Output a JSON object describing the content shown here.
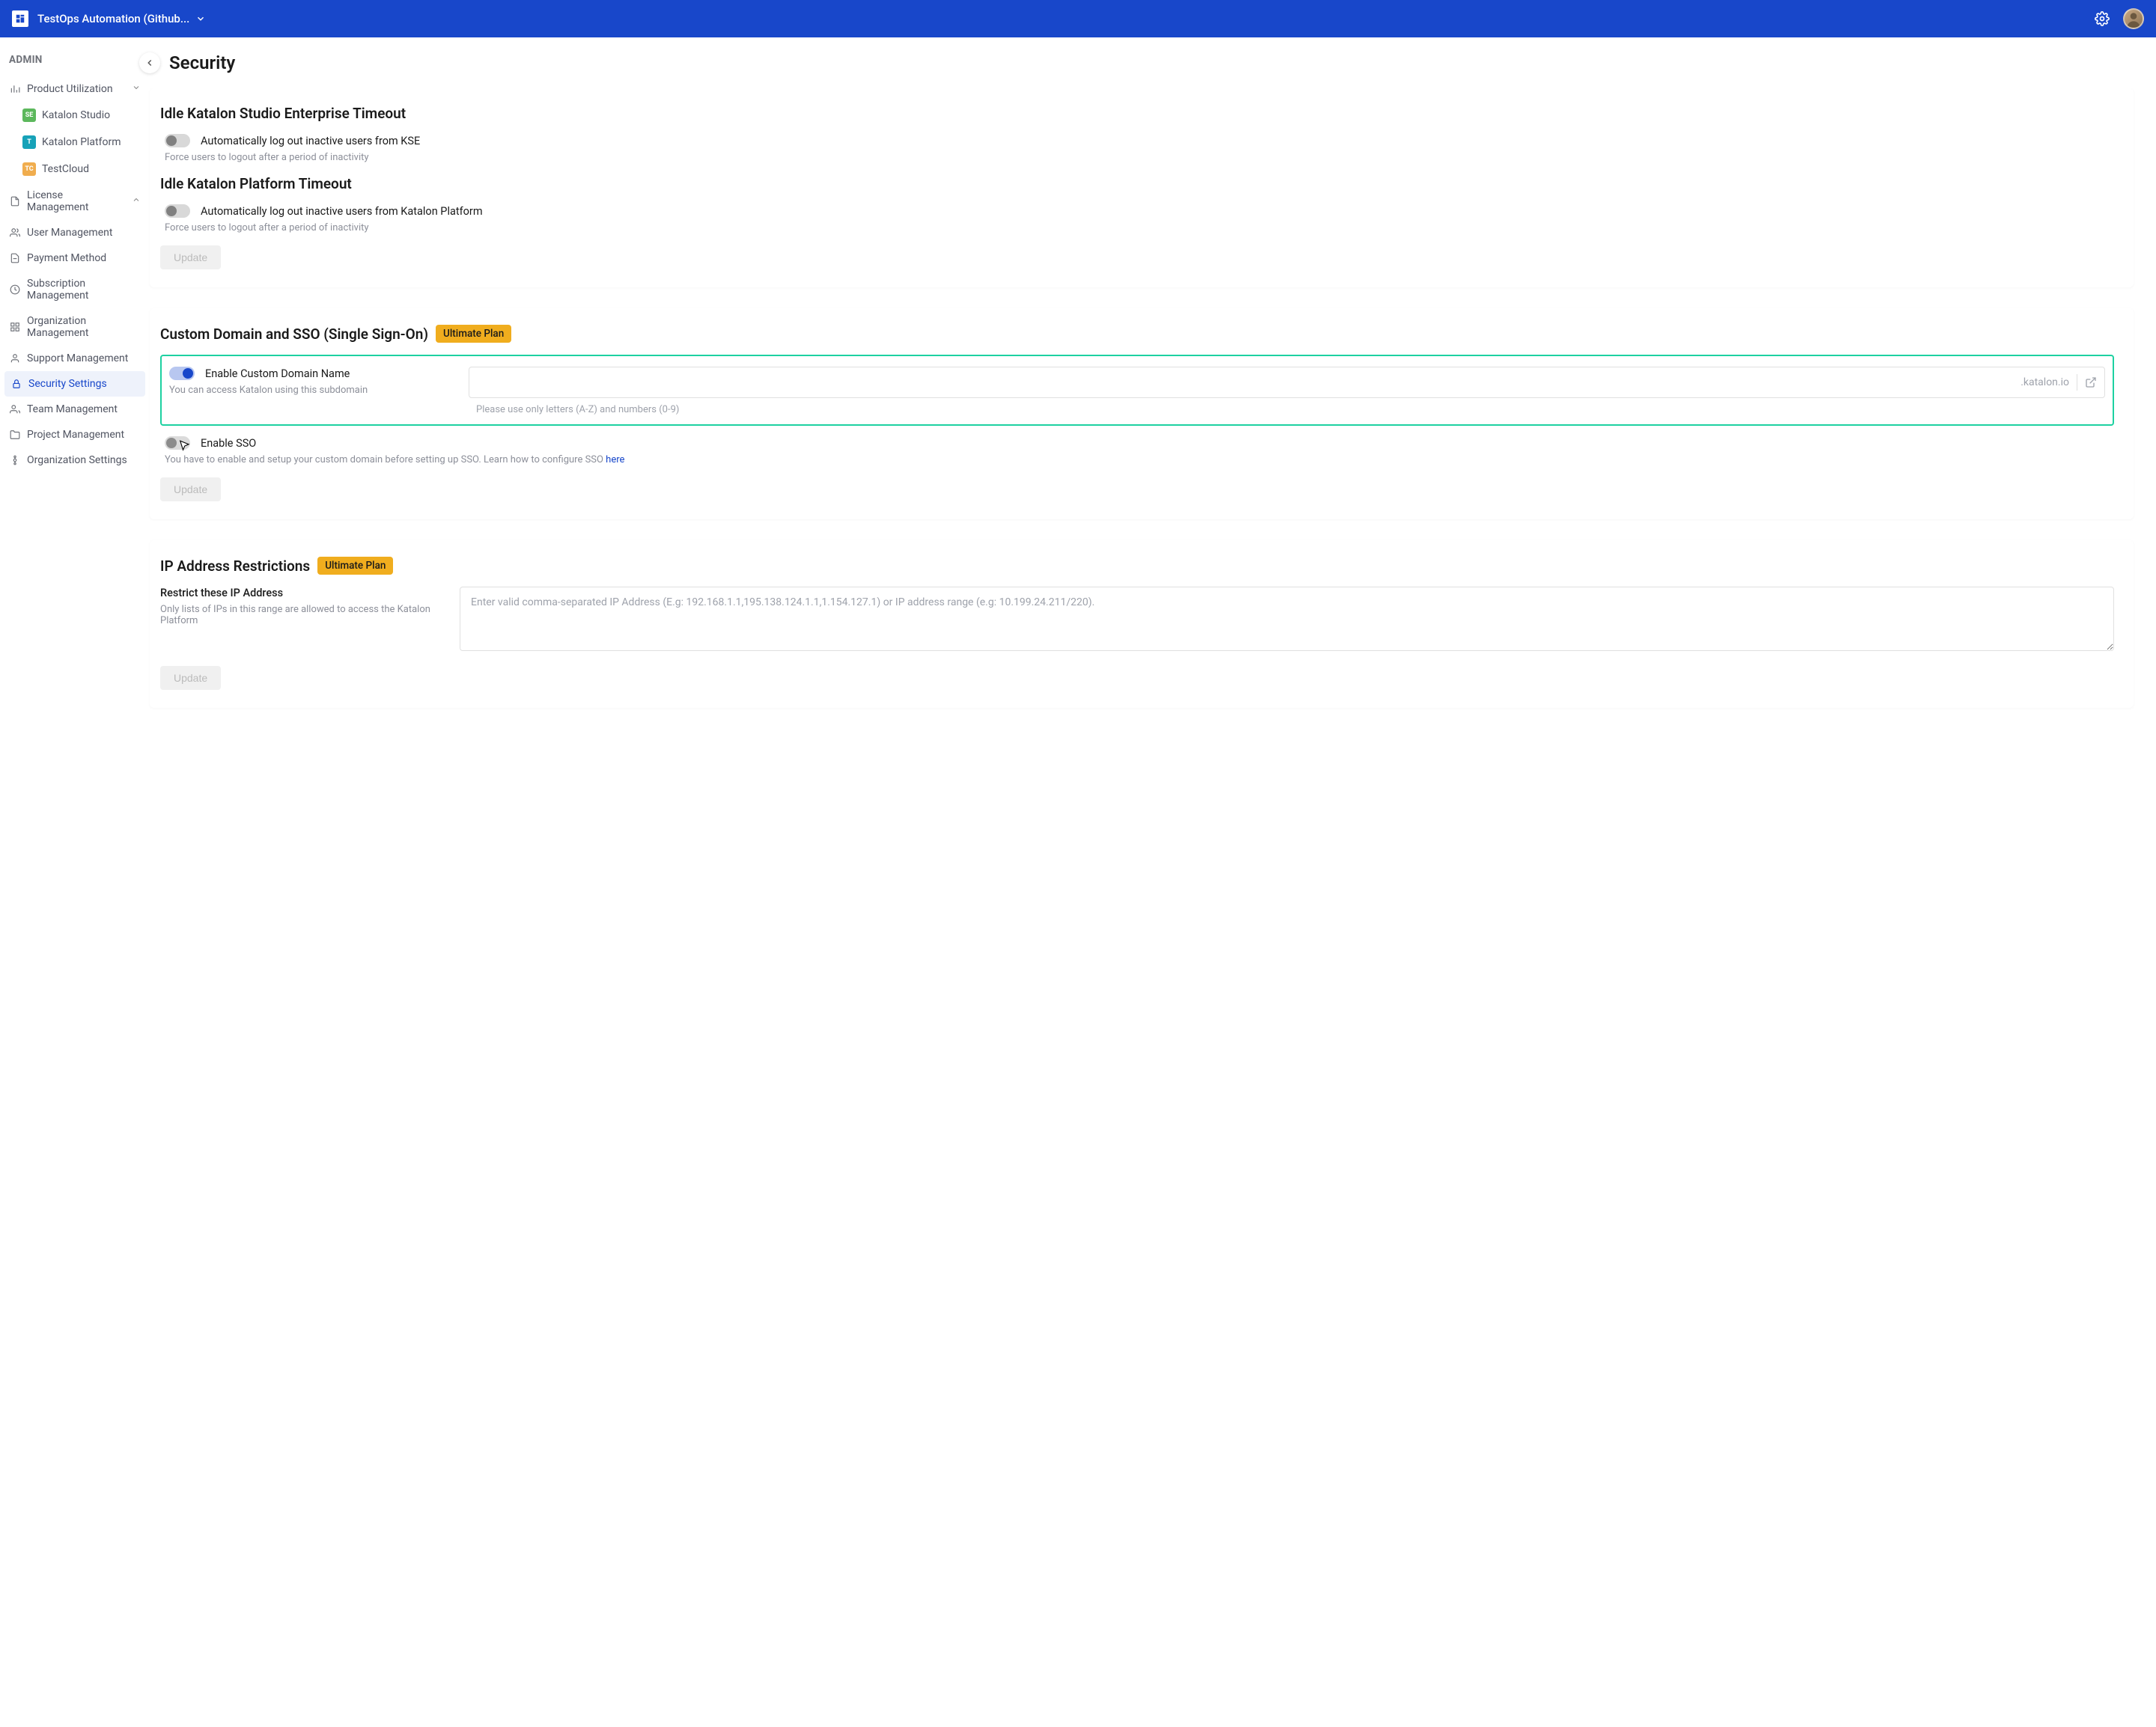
{
  "header": {
    "project": "TestOps Automation (Github..."
  },
  "sidebar": {
    "title": "ADMIN",
    "items": {
      "productUtilization": "Product Utilization",
      "katalonStudio": "Katalon Studio",
      "katalonPlatform": "Katalon Platform",
      "testCloud": "TestCloud",
      "licenseManagement": "License Management",
      "userManagement": "User Management",
      "paymentMethod": "Payment Method",
      "subscriptionManagement": "Subscription Management",
      "organizationManagement": "Organization Management",
      "supportManagement": "Support Management",
      "securitySettings": "Security Settings",
      "teamManagement": "Team Management",
      "projectManagement": "Project Management",
      "organizationSettings": "Organization Settings"
    }
  },
  "page": {
    "title": "Security"
  },
  "timeout": {
    "kseTitle": "Idle Katalon Studio Enterprise Timeout",
    "kseToggle": "Automatically log out inactive users from KSE",
    "kseHelper": "Force users to logout after a period of inactivity",
    "kpTitle": "Idle Katalon Platform Timeout",
    "kpToggle": "Automatically log out inactive users from Katalon Platform",
    "kpHelper": "Force users to logout after a period of inactivity",
    "update": "Update"
  },
  "sso": {
    "title": "Custom Domain and SSO (Single Sign-On)",
    "badge": "Ultimate Plan",
    "enableDomain": "Enable Custom Domain Name",
    "domainHelper": "You can access Katalon using this subdomain",
    "domainSuffix": ".katalon.io",
    "domainHint": "Please use only letters (A-Z) and numbers (0-9)",
    "enableSso": "Enable SSO",
    "ssoHelper": "You have to enable and setup your custom domain before setting up SSO. Learn how to configure SSO ",
    "ssoLink": "here",
    "update": "Update"
  },
  "ip": {
    "title": "IP Address Restrictions",
    "badge": "Ultimate Plan",
    "label": "Restrict these IP Address",
    "helper": "Only lists of IPs in this range are allowed to access the Katalon Platform",
    "placeholder": "Enter valid comma-separated IP Address (E.g: 192.168.1.1,195.138.124.1.1,1.154.127.1) or IP address range (e.g: 10.199.24.211/220).",
    "update": "Update"
  }
}
